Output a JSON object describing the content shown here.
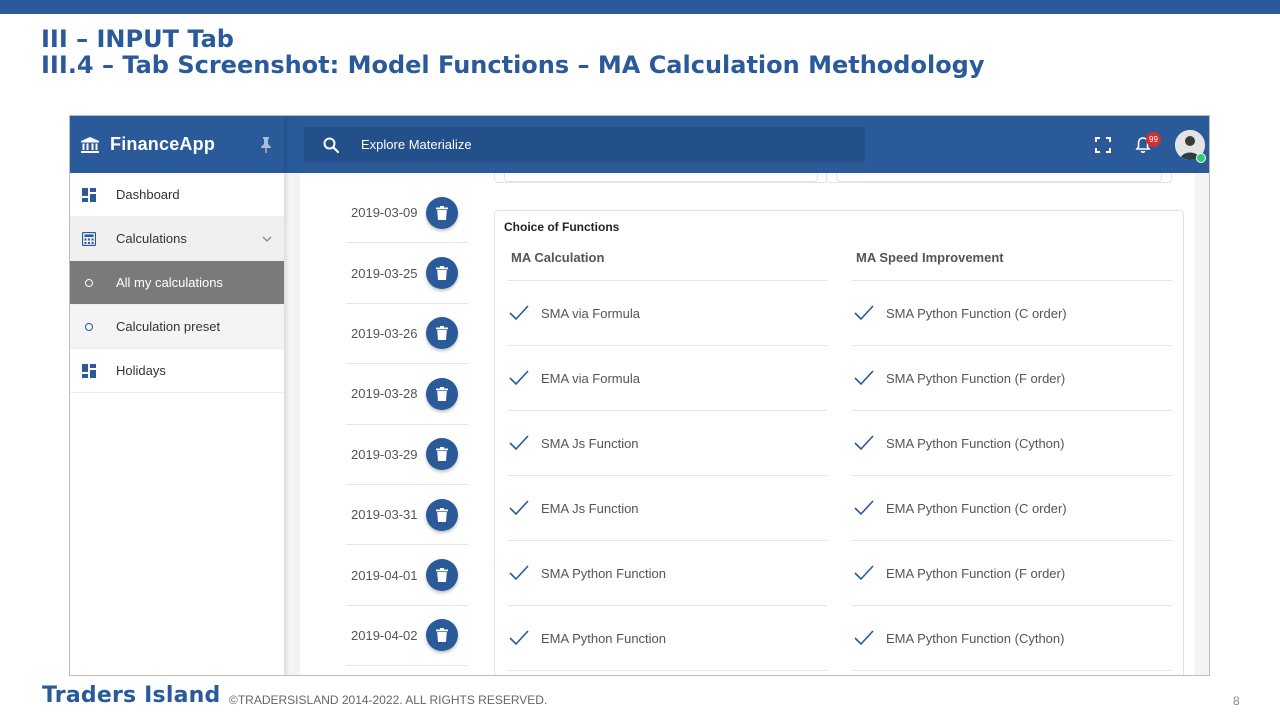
{
  "slide": {
    "title_line1": "III – INPUT Tab",
    "title_line2": "III.4 – Tab Screenshot: Model Functions – MA Calculation Methodology",
    "footer_brand": "Traders Island",
    "copyright": "©TRADERSISLAND 2014-2022. ALL RIGHTS RESERVED.",
    "page_number": "8"
  },
  "app": {
    "name": "FinanceApp",
    "search_placeholder": "Explore Materialize",
    "notification_count": "99",
    "accent_color": "#2a5a9a"
  },
  "sidebar": {
    "items": [
      {
        "label": "Dashboard",
        "icon": "dashboard-icon"
      },
      {
        "label": "Calculations",
        "icon": "calculator-icon"
      },
      {
        "label": "All my calculations",
        "icon": "circle-icon"
      },
      {
        "label": "Calculation preset",
        "icon": "circle-icon"
      },
      {
        "label": "Holidays",
        "icon": "dashboard-icon"
      }
    ]
  },
  "dates": [
    "2019-03-09",
    "2019-03-25",
    "2019-03-26",
    "2019-03-28",
    "2019-03-29",
    "2019-03-31",
    "2019-04-01",
    "2019-04-02"
  ],
  "functions": {
    "card_title": "Choice of Functions",
    "ma_calculation": {
      "header": "MA Calculation",
      "items": [
        "SMA via Formula",
        "EMA via Formula",
        "SMA Js Function",
        "EMA Js Function",
        "SMA Python Function",
        "EMA Python Function"
      ]
    },
    "ma_speed": {
      "header": "MA Speed Improvement",
      "items": [
        "SMA Python Function (C order)",
        "SMA Python Function (F order)",
        "SMA Python Function (Cython)",
        "EMA Python Function (C order)",
        "EMA Python Function (F order)",
        "EMA Python Function (Cython)"
      ]
    }
  }
}
